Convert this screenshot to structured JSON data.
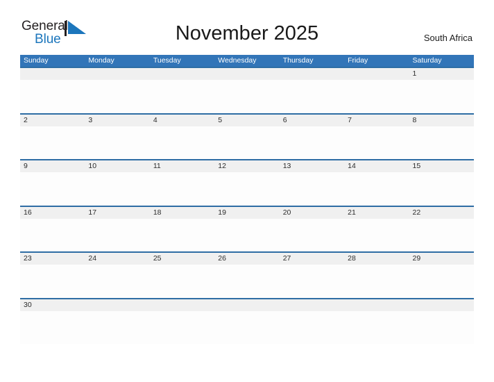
{
  "brand": {
    "word_one": "General",
    "word_two": "Blue",
    "flag_icon": "triangle-flag-icon",
    "color_primary": "#1c76bc",
    "color_text": "#231f20"
  },
  "header": {
    "title": "November 2025",
    "country": "South Africa"
  },
  "calendar": {
    "header_bg": "#3275b8",
    "row_divider": "#2e6da4",
    "band_bg": "#f0f0f0",
    "weekdays": [
      "Sunday",
      "Monday",
      "Tuesday",
      "Wednesday",
      "Thursday",
      "Friday",
      "Saturday"
    ],
    "weeks": [
      [
        "",
        "",
        "",
        "",
        "",
        "",
        "1"
      ],
      [
        "2",
        "3",
        "4",
        "5",
        "6",
        "7",
        "8"
      ],
      [
        "9",
        "10",
        "11",
        "12",
        "13",
        "14",
        "15"
      ],
      [
        "16",
        "17",
        "18",
        "19",
        "20",
        "21",
        "22"
      ],
      [
        "23",
        "24",
        "25",
        "26",
        "27",
        "28",
        "29"
      ],
      [
        "30",
        "",
        "",
        "",
        "",
        "",
        ""
      ]
    ]
  }
}
